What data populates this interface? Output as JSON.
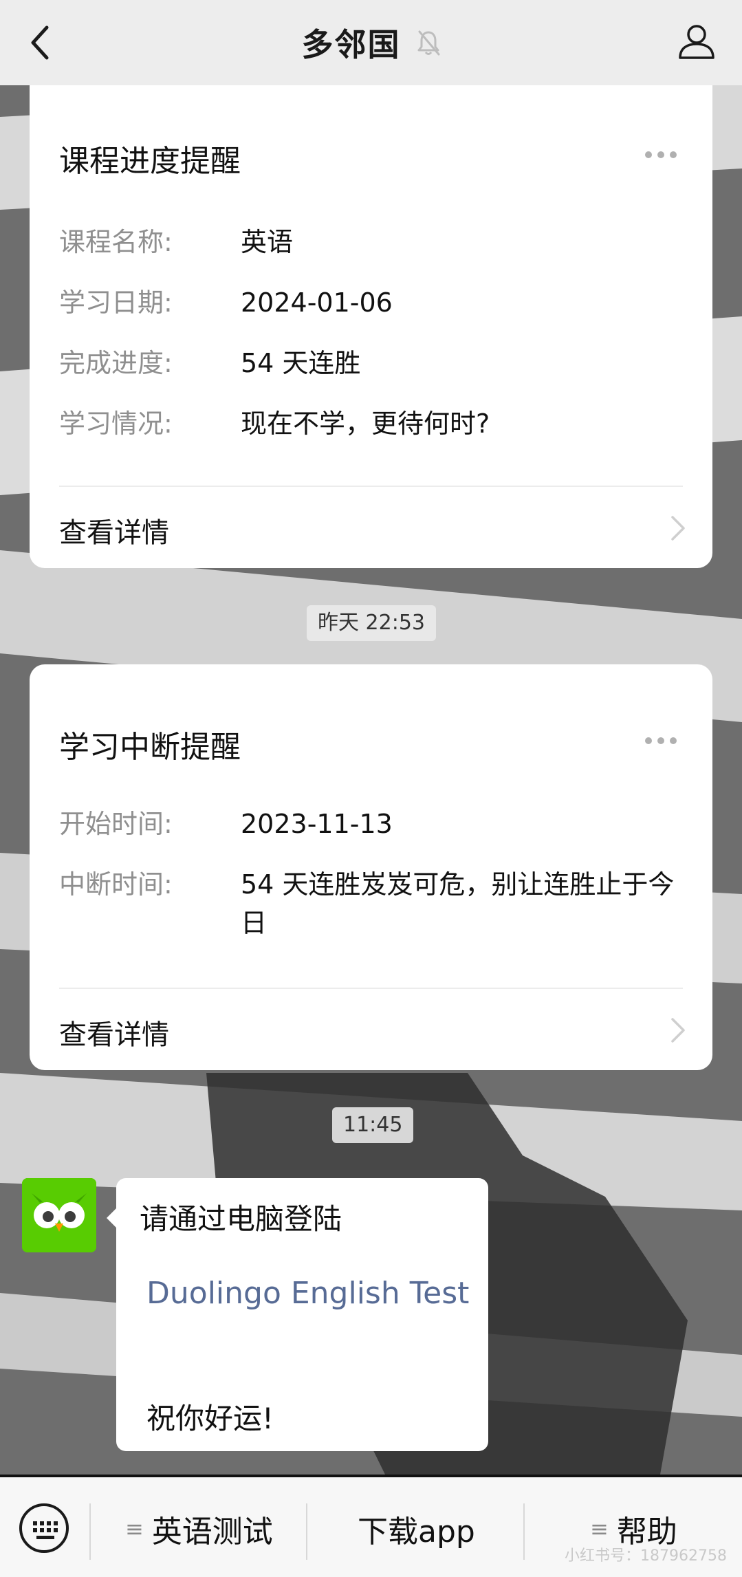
{
  "header": {
    "title": "多邻国"
  },
  "cards": [
    {
      "title": "课程进度提醒",
      "fields": [
        {
          "label": "课程名称:",
          "value": "英语"
        },
        {
          "label": "学习日期:",
          "value": "2024-01-06"
        },
        {
          "label": "完成进度:",
          "value": "54 天连胜"
        },
        {
          "label": "学习情况:",
          "value": "现在不学，更待何时?"
        }
      ],
      "detail_label": "查看详情"
    },
    {
      "title": "学习中断提醒",
      "fields": [
        {
          "label": "开始时间:",
          "value": "2023-11-13"
        },
        {
          "label": "中断时间:",
          "value": "54 天连胜岌岌可危，别让连胜止于今日"
        }
      ],
      "detail_label": "查看详情"
    }
  ],
  "timestamps": [
    "昨天 22:53",
    "11:45"
  ],
  "message": {
    "line1": "请通过电脑登陆",
    "link": "Duolingo English Test",
    "line3": "祝你好运!"
  },
  "bottom_menu": {
    "items": [
      "英语测试",
      "下载app",
      "帮助"
    ],
    "menu_icon": "≡",
    "watermark": "小红书号：187962758"
  },
  "colors": {
    "link": "#576b95",
    "duolingo_green": "#58cc02",
    "nav_bg": "#ededed"
  }
}
